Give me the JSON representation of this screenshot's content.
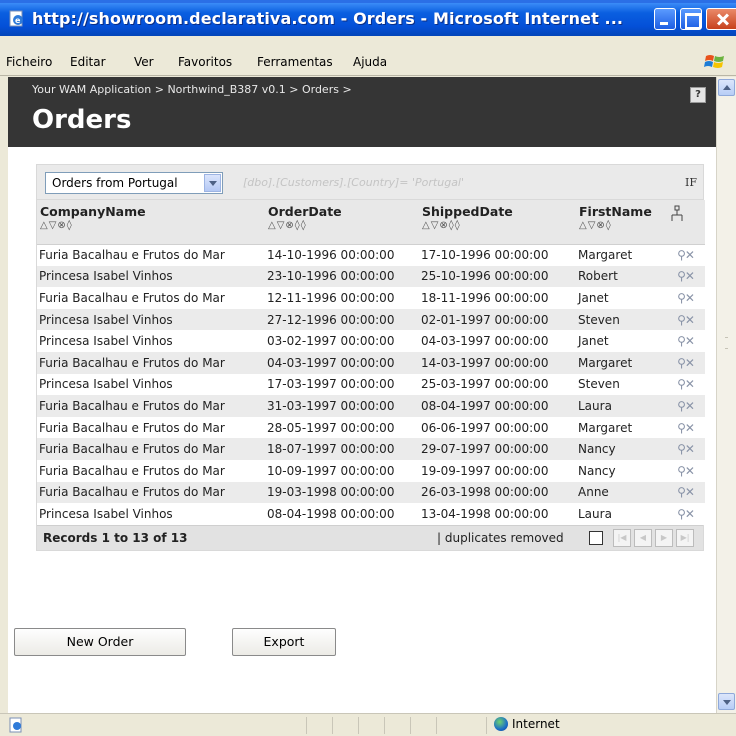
{
  "window": {
    "title": "http://showroom.declarativa.com - Orders - Microsoft Internet ..."
  },
  "menu": [
    "Ficheiro",
    "Editar",
    "Ver",
    "Favoritos",
    "Ferramentas",
    "Ajuda"
  ],
  "header": {
    "breadcrumb": "Your WAM Application > Northwind_B387 v0.1 > Orders >",
    "title": "Orders",
    "help_label": "?"
  },
  "filter": {
    "selected": "Orders from Portugal",
    "expression": "[dbo].[Customers].[Country]= 'Portugal'",
    "if_label": "IF"
  },
  "columns": [
    {
      "label": "CompanyName",
      "sort": "△▽⊗◊"
    },
    {
      "label": "OrderDate",
      "sort": "△▽⊗◊◊"
    },
    {
      "label": "ShippedDate",
      "sort": "△▽⊗◊◊"
    },
    {
      "label": "FirstName",
      "sort": "△▽⊗◊"
    }
  ],
  "rows": [
    [
      "Furia Bacalhau e Frutos do Mar",
      "14-10-1996 00:00:00",
      "17-10-1996 00:00:00",
      "Margaret"
    ],
    [
      "Princesa Isabel Vinhos",
      "23-10-1996 00:00:00",
      "25-10-1996 00:00:00",
      "Robert"
    ],
    [
      "Furia Bacalhau e Frutos do Mar",
      "12-11-1996 00:00:00",
      "18-11-1996 00:00:00",
      "Janet"
    ],
    [
      "Princesa Isabel Vinhos",
      "27-12-1996 00:00:00",
      "02-01-1997 00:00:00",
      "Steven"
    ],
    [
      "Princesa Isabel Vinhos",
      "03-02-1997 00:00:00",
      "04-03-1997 00:00:00",
      "Janet"
    ],
    [
      "Furia Bacalhau e Frutos do Mar",
      "04-03-1997 00:00:00",
      "14-03-1997 00:00:00",
      "Margaret"
    ],
    [
      "Princesa Isabel Vinhos",
      "17-03-1997 00:00:00",
      "25-03-1997 00:00:00",
      "Steven"
    ],
    [
      "Furia Bacalhau e Frutos do Mar",
      "31-03-1997 00:00:00",
      "08-04-1997 00:00:00",
      "Laura"
    ],
    [
      "Furia Bacalhau e Frutos do Mar",
      "28-05-1997 00:00:00",
      "06-06-1997 00:00:00",
      "Margaret"
    ],
    [
      "Furia Bacalhau e Frutos do Mar",
      "18-07-1997 00:00:00",
      "29-07-1997 00:00:00",
      "Nancy"
    ],
    [
      "Furia Bacalhau e Frutos do Mar",
      "10-09-1997 00:00:00",
      "19-09-1997 00:00:00",
      "Nancy"
    ],
    [
      "Furia Bacalhau e Frutos do Mar",
      "19-03-1998 00:00:00",
      "26-03-1998 00:00:00",
      "Anne"
    ],
    [
      "Princesa Isabel Vinhos",
      "08-04-1998 00:00:00",
      "13-04-1998 00:00:00",
      "Laura"
    ]
  ],
  "row_actions": {
    "view_icon": "magnifier-icon",
    "delete_icon": "delete-x-icon"
  },
  "footer": {
    "records": "Records 1 to 13 of 13",
    "duplicates": "| duplicates removed"
  },
  "buttons": {
    "new_order": "New Order",
    "export": "Export"
  },
  "status": {
    "zone": "Internet"
  },
  "colors": {
    "titlebar": "#0a5fe0",
    "header_bg": "#353535",
    "row_alt": "#ebebeb"
  }
}
